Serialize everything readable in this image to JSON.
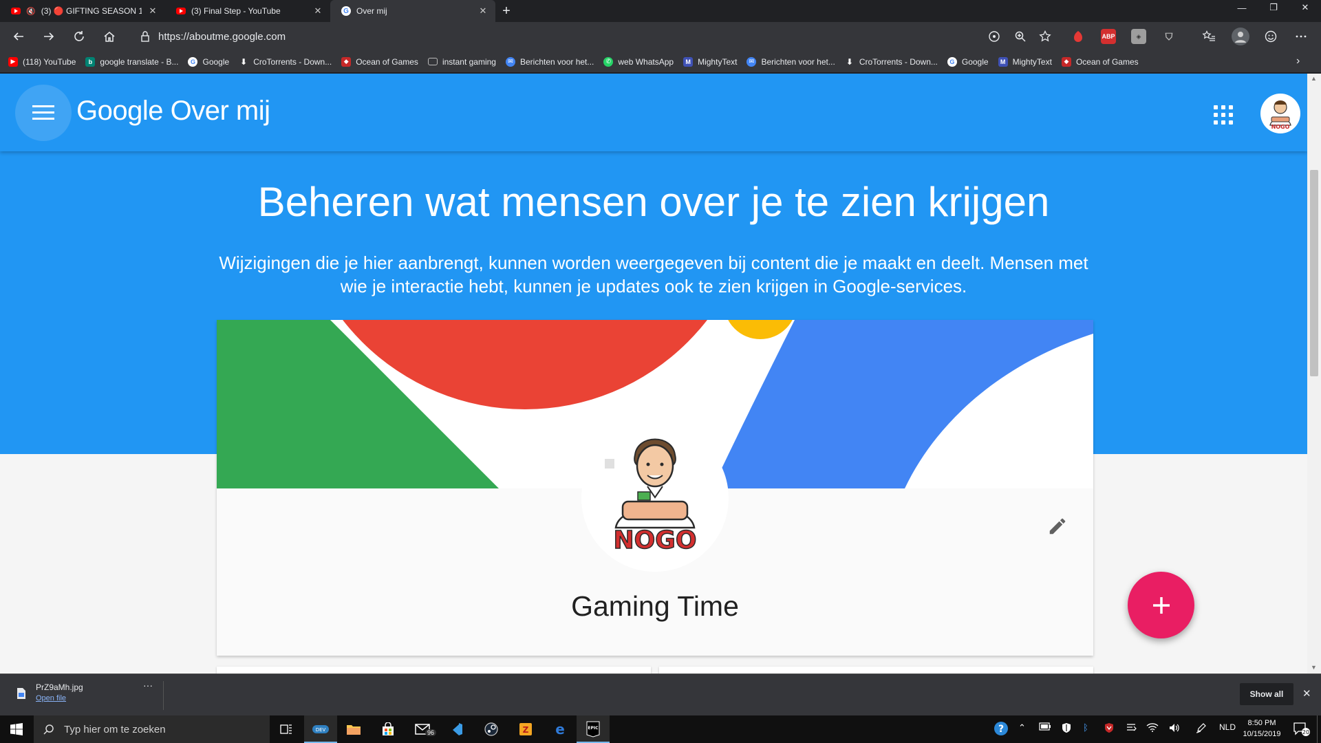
{
  "tabs": [
    {
      "title": "(3) 🔴 GIFTING SEASON 1 I",
      "muted": true,
      "recording": true
    },
    {
      "title": "(3) Final Step - YouTube"
    },
    {
      "title": "Over mij",
      "active": true
    }
  ],
  "address": {
    "url": "https://aboutme.google.com"
  },
  "bookmarks": [
    {
      "label": "(118) YouTube",
      "icon": "youtube-icon",
      "color": "#ff0000"
    },
    {
      "label": "google translate - B...",
      "icon": "bing-icon",
      "color": "#008373"
    },
    {
      "label": "Google",
      "icon": "google-icon",
      "color": "#ffffff"
    },
    {
      "label": "CroTorrents - Down...",
      "icon": "download-icon",
      "color": "#ffffff"
    },
    {
      "label": "Ocean of Games",
      "icon": "gamepad-icon",
      "color": "#c62828"
    },
    {
      "label": "instant gaming",
      "icon": "folder-icon",
      "color": "#9e9e9e"
    },
    {
      "label": "Berichten voor het...",
      "icon": "messages-icon",
      "color": "#4285f4"
    },
    {
      "label": "web WhatsApp",
      "icon": "whatsapp-icon",
      "color": "#25d366"
    },
    {
      "label": "MightyText",
      "icon": "mightytext-icon",
      "color": "#3f51b5"
    },
    {
      "label": "Berichten voor het...",
      "icon": "messages-icon",
      "color": "#4285f4"
    },
    {
      "label": "CroTorrents - Down...",
      "icon": "download-icon",
      "color": "#ffffff"
    },
    {
      "label": "Google",
      "icon": "google-icon",
      "color": "#ffffff"
    },
    {
      "label": "MightyText",
      "icon": "mightytext-icon",
      "color": "#3f51b5"
    },
    {
      "label": "Ocean of Games",
      "icon": "gamepad-icon",
      "color": "#c62828"
    }
  ],
  "extensions": {
    "abp_label": "ABP"
  },
  "app": {
    "brand": "Google Over mij",
    "avatar_text": "NOGO"
  },
  "hero": {
    "headline": "Beheren wat mensen over je te zien krijgen",
    "subtext": "Wijzigingen die je hier aanbrengt, kunnen worden weergegeven bij content die je maakt en deelt. Mensen met wie je interactie hebt, kunnen je updates ook te zien krijgen in Google-services."
  },
  "profile": {
    "name": "Gaming Time",
    "photo_text": "NOGO"
  },
  "colors": {
    "brand_blue": "#2196f3",
    "fab_pink": "#e91e63",
    "google_red": "#ea4335",
    "google_green": "#34a853",
    "google_blue": "#4285f4",
    "google_yellow": "#fbbc05"
  },
  "download": {
    "filename": "PrZ9aMh.jpg",
    "action": "Open file",
    "show_all": "Show all"
  },
  "taskbar": {
    "search_placeholder": "Typ hier om te zoeken",
    "mail_badge": "96",
    "epic_label": "EPIC",
    "language": "NLD",
    "time": "8:50 PM",
    "date": "10/15/2019",
    "notifications": "20"
  }
}
